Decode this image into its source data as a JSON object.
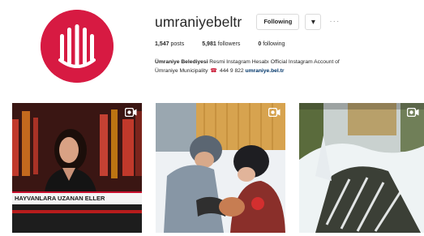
{
  "profile": {
    "username": "umraniyebeltr",
    "follow_label": "Following",
    "dropdown_glyph": "▾",
    "more_glyph": "···",
    "stats": {
      "posts_count": "1,547",
      "posts_label": "posts",
      "followers_count": "5,981",
      "followers_label": "followers",
      "following_count": "0",
      "following_label": "following"
    },
    "bio": {
      "name": "Ümraniye Belediyesi",
      "line1": " Resmi Instagram Hesabı Official Instagram Account of",
      "line2": "Ümraniye Municipality ",
      "phone_icon": "☎",
      "phone": " 444 9 822 ",
      "link": "umraniye.bel.tr"
    }
  },
  "posts": [
    {
      "name": "post-news",
      "is_video": true,
      "caption": "HAYVANLARA UZANAN ELLER"
    },
    {
      "name": "post-snow-children",
      "is_video": true
    },
    {
      "name": "post-snow-yard",
      "is_video": true
    }
  ],
  "colors": {
    "brand_red": "#d71a42",
    "link_blue": "#003569",
    "border_gray": "#dbdbdb"
  },
  "icons": {
    "avatar": "umraniye-logo-icon",
    "video": "video-camera-icon",
    "phone": "phone-icon"
  }
}
